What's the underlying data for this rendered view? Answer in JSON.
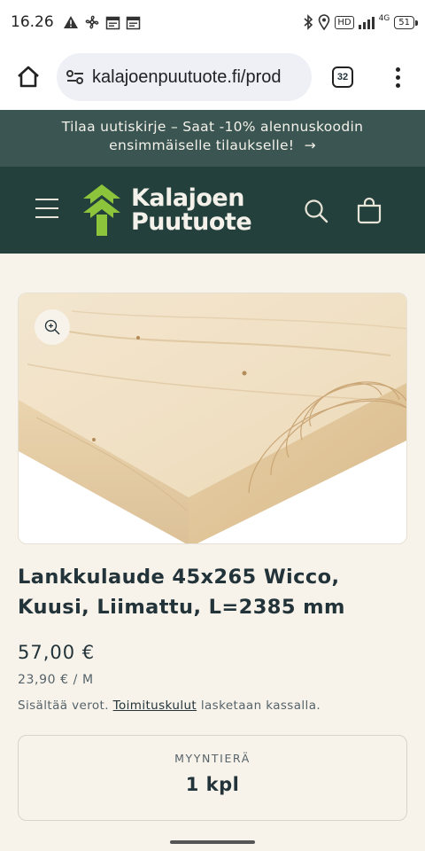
{
  "status_bar": {
    "time": "16.26",
    "hd_label": "HD",
    "network_label": "4G",
    "battery": "51",
    "icons": [
      "warning-icon",
      "fan-icon",
      "calendar-icon",
      "calendar-icon",
      "bluetooth-icon",
      "location-icon",
      "hd-icon",
      "signal-icon",
      "battery-icon"
    ]
  },
  "browser": {
    "url": "kalajoenpuutuote.fi/prod",
    "tab_count": "32",
    "icons": [
      "home-icon",
      "site-settings-icon",
      "tabs-icon",
      "more-vert-icon"
    ]
  },
  "announcement": {
    "text_line1": "Tilaa uutiskirje – Saat -10% alennuskoodin",
    "text_line2": "ensimmäiselle tilaukselle!",
    "arrow": "→"
  },
  "header": {
    "logo_line1": "Kalajoen",
    "logo_line2": "Puutuote",
    "icons": [
      "menu-icon",
      "tree-logo-icon",
      "search-icon",
      "cart-icon"
    ],
    "colors": {
      "bg": "#23403d",
      "logo_green": "#8cc43c"
    }
  },
  "product": {
    "title_line1": "Lankkulaude 45x265 Wicco,",
    "title_line2": "Kuusi, Liimattu, L=2385 mm",
    "price": "57,00 €",
    "unit_price": "23,90 € / M",
    "tax_prefix": "Sisältää verot.",
    "shipping_link": "Toimituskulut",
    "tax_suffix": "lasketaan kassalla.",
    "lot_label": "MYYNTIERÄ",
    "lot_value": "1 kpl"
  }
}
